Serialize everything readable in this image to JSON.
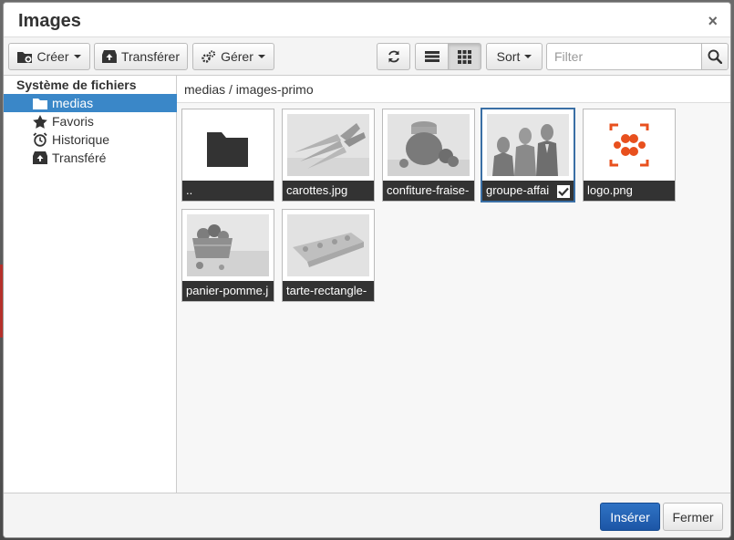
{
  "dialog": {
    "title": "Images",
    "close": "×"
  },
  "toolbar": {
    "create_label": "Créer",
    "upload_label": "Transférer",
    "manage_label": "Gérer",
    "sort_label": "Sort",
    "filter_placeholder": "Filter"
  },
  "sidebar": {
    "root": "Système de fichiers",
    "items": [
      {
        "label": "medias",
        "icon": "folder-icon",
        "selected": true
      },
      {
        "label": "Favoris",
        "icon": "star-icon",
        "selected": false
      },
      {
        "label": "Historique",
        "icon": "alarm-clock-icon",
        "selected": false
      },
      {
        "label": "Transféré",
        "icon": "upload-box-icon",
        "selected": false
      }
    ]
  },
  "breadcrumb": "medias / images-primo",
  "files": [
    {
      "name": "..",
      "kind": "parent-folder",
      "selected": false
    },
    {
      "name": "carottes.jpg",
      "kind": "image",
      "selected": false
    },
    {
      "name": "confiture-fraise-",
      "kind": "image",
      "selected": false
    },
    {
      "name": "groupe-affai",
      "kind": "image",
      "selected": true
    },
    {
      "name": "logo.png",
      "kind": "logo",
      "selected": false
    },
    {
      "name": "panier-pomme.j",
      "kind": "image",
      "selected": false
    },
    {
      "name": "tarte-rectangle-",
      "kind": "image",
      "selected": false
    }
  ],
  "footer": {
    "insert_label": "Insérer",
    "close_label": "Fermer"
  },
  "colors": {
    "accent": "#3a87c8",
    "primary_button": "#1c56a6",
    "logo": "#e8501e",
    "caption_bg": "#333333"
  }
}
